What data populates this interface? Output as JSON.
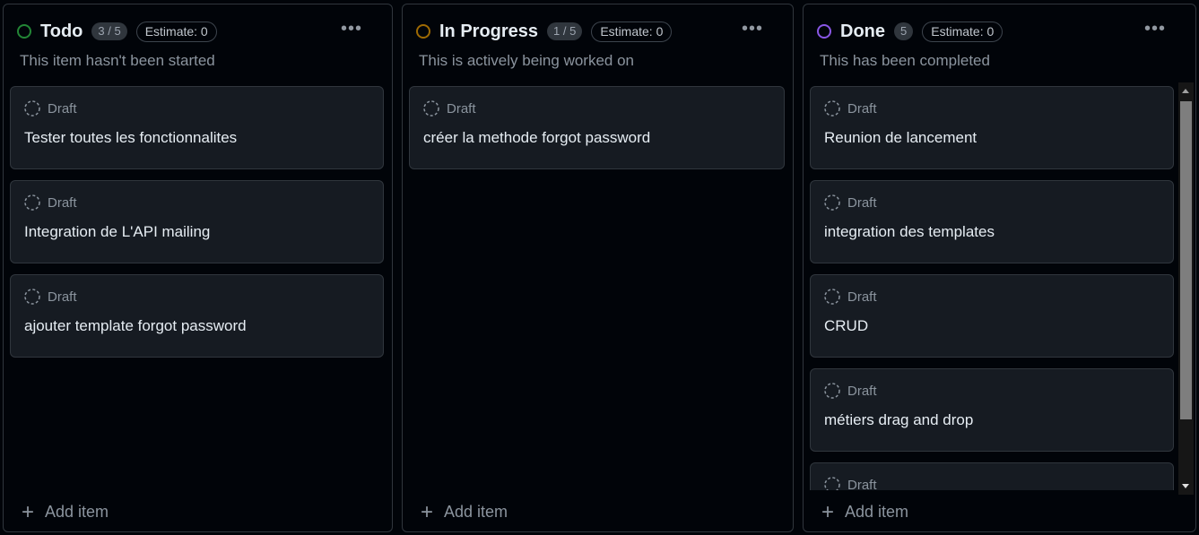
{
  "columns": [
    {
      "id": "todo",
      "title": "Todo",
      "count": "3 / 5",
      "estimate": "Estimate: 0",
      "description": "This item hasn't been started",
      "color": "#238636",
      "cards": [
        {
          "status": "Draft",
          "title": "Tester toutes les fonctionnalites"
        },
        {
          "status": "Draft",
          "title": "Integration de L'API mailing"
        },
        {
          "status": "Draft",
          "title": "ajouter template forgot password"
        }
      ],
      "add_label": "Add item"
    },
    {
      "id": "inprogress",
      "title": "In Progress",
      "count": "1 / 5",
      "estimate": "Estimate: 0",
      "description": "This is actively being worked on",
      "color": "#9e6a03",
      "cards": [
        {
          "status": "Draft",
          "title": "créer la methode forgot password"
        }
      ],
      "add_label": "Add item"
    },
    {
      "id": "done",
      "title": "Done",
      "count": "5",
      "estimate": "Estimate: 0",
      "description": "This has been completed",
      "color": "#8957e5",
      "cards": [
        {
          "status": "Draft",
          "title": "Reunion de lancement"
        },
        {
          "status": "Draft",
          "title": "integration des templates"
        },
        {
          "status": "Draft",
          "title": "CRUD"
        },
        {
          "status": "Draft",
          "title": "métiers drag and drop"
        },
        {
          "status": "Draft",
          "title": ""
        }
      ],
      "add_label": "Add item"
    }
  ],
  "icons": {
    "status": "circle-icon",
    "draft": "dashed-circle-icon",
    "more": "more-horizontal-icon",
    "add": "plus-icon"
  }
}
